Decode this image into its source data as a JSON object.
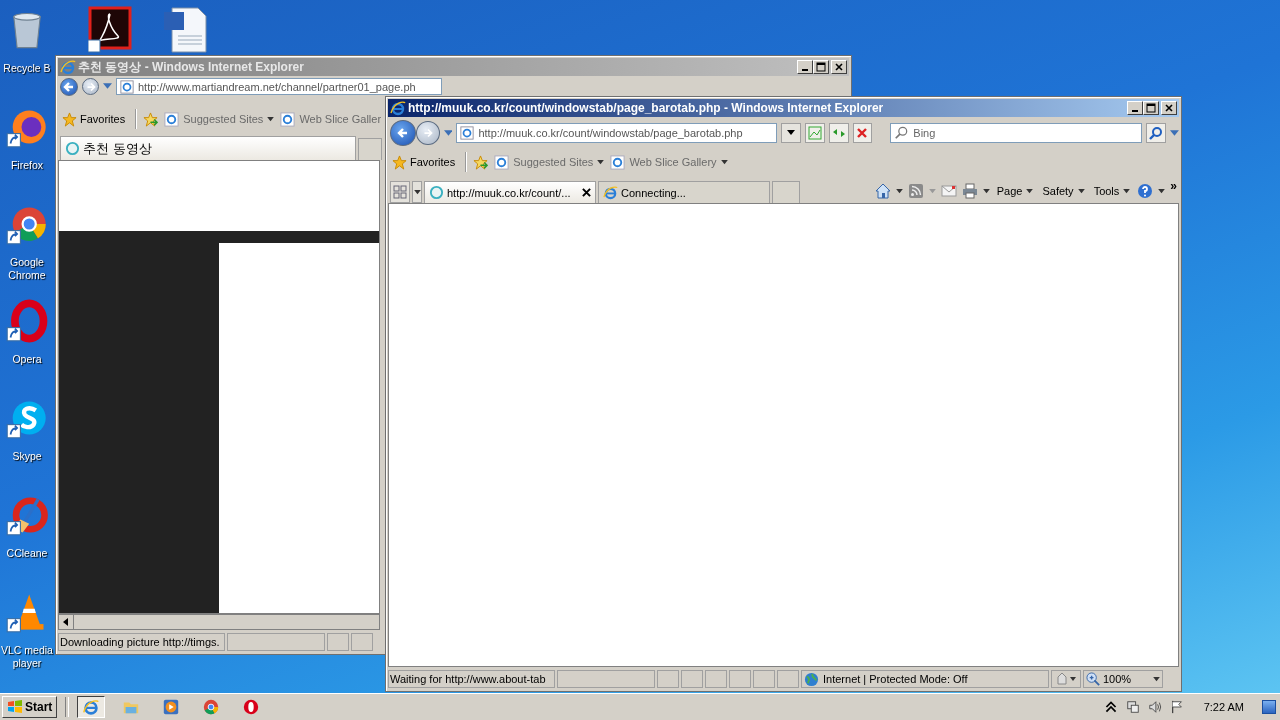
{
  "desktop": {
    "column_icons": [
      {
        "kind": "recycle",
        "label": "Recycle B"
      },
      {
        "kind": "firefox",
        "label": "Firefox"
      },
      {
        "kind": "chrome",
        "label": "Google Chrome"
      },
      {
        "kind": "opera",
        "label": "Opera"
      },
      {
        "kind": "skype",
        "label": "Skype"
      },
      {
        "kind": "ccleaner",
        "label": "CCleane"
      },
      {
        "kind": "vlc",
        "label": "VLC media player"
      }
    ],
    "top_icons": [
      {
        "kind": "acrobat"
      },
      {
        "kind": "word"
      }
    ]
  },
  "windows": [
    {
      "title": "추천 동영상 - Windows Internet Explorer",
      "active": false,
      "address": "http://www.martiandream.net/channel/partner01_page.ph",
      "favorites_label": "Favorites",
      "favorites_links": [
        {
          "label": "Suggested Sites",
          "dropdown": true
        },
        {
          "label": "Web Slice Galler",
          "dropdown": false
        }
      ],
      "tabs": [
        {
          "label": "추천 동영상",
          "selected": true,
          "kind": "loading"
        }
      ],
      "page": {
        "kind": "dark_page"
      },
      "status_text": "Downloading picture http://timgs."
    },
    {
      "title": "http://muuk.co.kr/count/windowstab/page_barotab.php - Windows Internet Explorer",
      "active": true,
      "address": "http://muuk.co.kr/count/windowstab/page_barotab.php",
      "search_placeholder": "Bing",
      "favorites_label": "Favorites",
      "favorites_links": [
        {
          "label": "Suggested Sites",
          "dropdown": true
        },
        {
          "label": "Web Slice Gallery",
          "dropdown": true
        }
      ],
      "tabs": [
        {
          "label": "http://muuk.co.kr/count/...",
          "selected": true,
          "kind": "loading"
        },
        {
          "label": "Connecting...",
          "selected": false,
          "kind": "ie"
        }
      ],
      "commands": [
        "Page",
        "Safety",
        "Tools"
      ],
      "overflow": "»",
      "page": {
        "kind": "blank"
      },
      "status_text": "Waiting for http://www.about-tab",
      "zone": "Internet | Protected Mode: Off",
      "zoom": "100%"
    }
  ],
  "taskbar": {
    "start_label": "Start",
    "pinned": [
      {
        "kind": "ie",
        "selected": true
      },
      {
        "kind": "folder",
        "selected": false
      },
      {
        "kind": "media",
        "selected": false
      },
      {
        "kind": "chrome",
        "selected": false
      },
      {
        "kind": "opera",
        "selected": false
      }
    ],
    "clock": "7:22 AM"
  }
}
